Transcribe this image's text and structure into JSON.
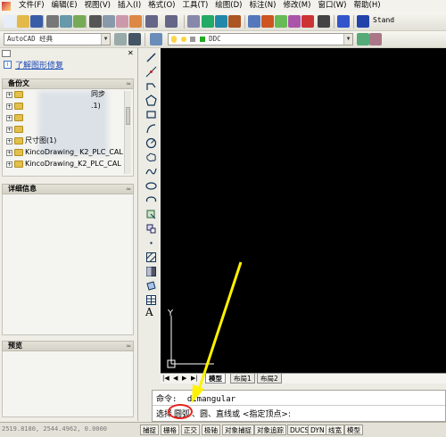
{
  "menu": [
    "文件(F)",
    "编辑(E)",
    "视图(V)",
    "插入(I)",
    "格式(O)",
    "工具(T)",
    "绘图(D)",
    "标注(N)",
    "修改(M)",
    "窗口(W)",
    "帮助(H)"
  ],
  "toolbar": {
    "workspace_value": "AutoCAD 经典",
    "layer_value": "DDC",
    "std_label": "Stand"
  },
  "left_panel": {
    "link_text": "了解图形修复",
    "backup_header": "备份文",
    "tree_items": [
      {
        "label": "",
        "suffix": "同步"
      },
      {
        "label": "",
        "suffix": ".1)"
      },
      {
        "label": "",
        "suffix": ""
      },
      {
        "label": "",
        "suffix": ""
      },
      {
        "label": "尺寸图(1)",
        "suffix": ""
      },
      {
        "label": "KincoDrawing_",
        "suffix": "K2_PLC_CAL"
      },
      {
        "label": "KincoDrawing_K2_PLC_CAL",
        "suffix": ""
      }
    ],
    "details_header": "详细信息",
    "preview_header": "预览"
  },
  "tabs": [
    "模型",
    "布局1",
    "布局2"
  ],
  "command": {
    "line1_prefix": "命令:",
    "line1_value": "dimangular",
    "line2_prefix": "选择",
    "line2_highlight": "圆弧",
    "line2_rest": "、圆、直线或 <指定顶点>:"
  },
  "status": {
    "coords": "2519.8180, 2544.4962, 0.0000",
    "buttons": [
      "捕捉",
      "栅格",
      "正交",
      "极轴",
      "对象捕捉",
      "对象追踪",
      "DUCS",
      "DYN",
      "线宽",
      "模型"
    ]
  },
  "ucs": {
    "y_label": "Y"
  }
}
